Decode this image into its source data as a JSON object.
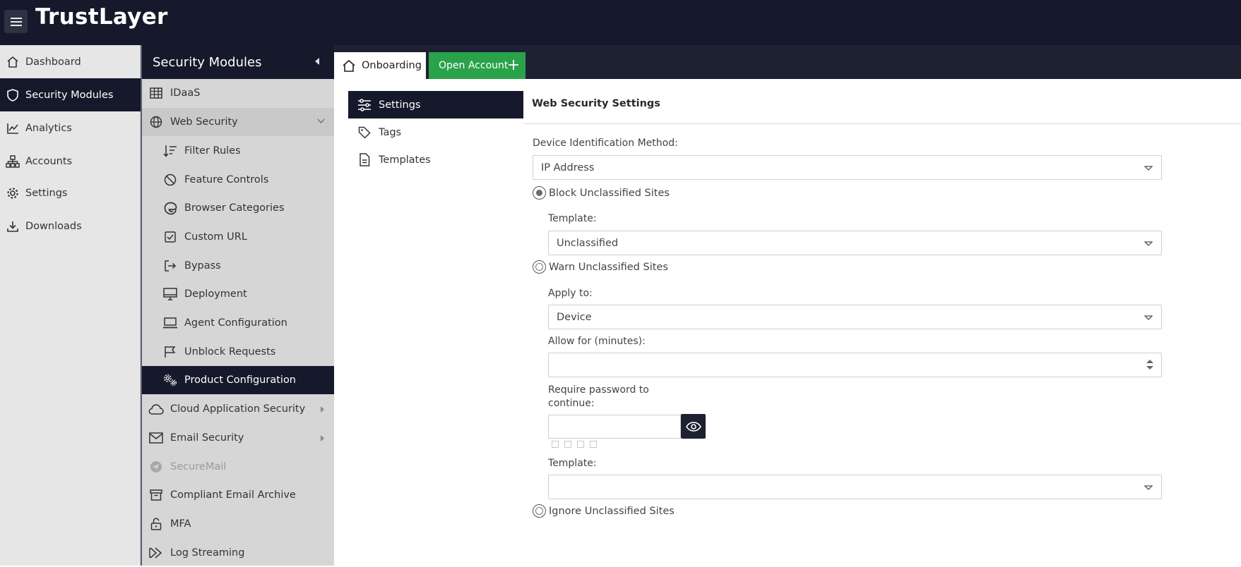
{
  "app": {
    "brand": "TrustLayer"
  },
  "left_nav": [
    {
      "label": "Dashboard",
      "icon": "home-icon"
    },
    {
      "label": "Security Modules",
      "icon": "shield-icon",
      "active": true
    },
    {
      "label": "Analytics",
      "icon": "analytics-icon"
    },
    {
      "label": "Accounts",
      "icon": "org-chart-icon"
    },
    {
      "label": "Settings",
      "icon": "gear-icon"
    },
    {
      "label": "Downloads",
      "icon": "download-icon"
    }
  ],
  "modules": {
    "title": "Security Modules",
    "items": [
      {
        "label": "IDaaS",
        "icon": "table-icon"
      },
      {
        "label": "Web Security",
        "icon": "globe-icon"
      },
      {
        "label": "Filter Rules",
        "icon": "sort-filter-icon"
      },
      {
        "label": "Feature Controls",
        "icon": "block-icon"
      },
      {
        "label": "Browser Categories",
        "icon": "browser-icon"
      },
      {
        "label": "Custom URL",
        "icon": "checkbox-icon"
      },
      {
        "label": "Bypass",
        "icon": "exit-icon"
      },
      {
        "label": "Deployment",
        "icon": "monitor-icon"
      },
      {
        "label": "Agent Configuration",
        "icon": "laptop-icon"
      },
      {
        "label": "Unblock Requests",
        "icon": "flag-icon"
      },
      {
        "label": "Product Configuration",
        "icon": "gears-icon"
      },
      {
        "label": "Cloud Application Security",
        "icon": "cloud-icon"
      },
      {
        "label": "Email Security",
        "icon": "envelope-icon"
      },
      {
        "label": "SecureMail",
        "icon": "send-icon"
      },
      {
        "label": "Compliant Email Archive",
        "icon": "archive-icon"
      },
      {
        "label": "MFA",
        "icon": "unlock-icon"
      },
      {
        "label": "Log Streaming",
        "icon": "stream-icon"
      }
    ]
  },
  "tabs": {
    "onboarding": "Onboarding",
    "open_account": "Open Account"
  },
  "subnav": [
    {
      "label": "Settings",
      "icon": "sliders-icon",
      "active": true
    },
    {
      "label": "Tags",
      "icon": "tag-icon"
    },
    {
      "label": "Templates",
      "icon": "document-icon"
    }
  ],
  "form": {
    "title": "Web Security Settings",
    "device_id_label": "Device Identification Method:",
    "device_id_value": "IP Address",
    "block_label": "Block Unclassified Sites",
    "block_template_label": "Template:",
    "block_template_value": "Unclassified",
    "warn_label": "Warn Unclassified Sites",
    "apply_to_label": "Apply to:",
    "apply_to_value": "Device",
    "allow_for_label": "Allow for (minutes):",
    "allow_for_value": "",
    "require_password_line1": "Require password to",
    "require_password_line2": "continue:",
    "password_value": "",
    "warn_template_label": "Template:",
    "warn_template_value": "",
    "ignore_label": "Ignore Unclassified Sites",
    "selected_mode": "block"
  }
}
